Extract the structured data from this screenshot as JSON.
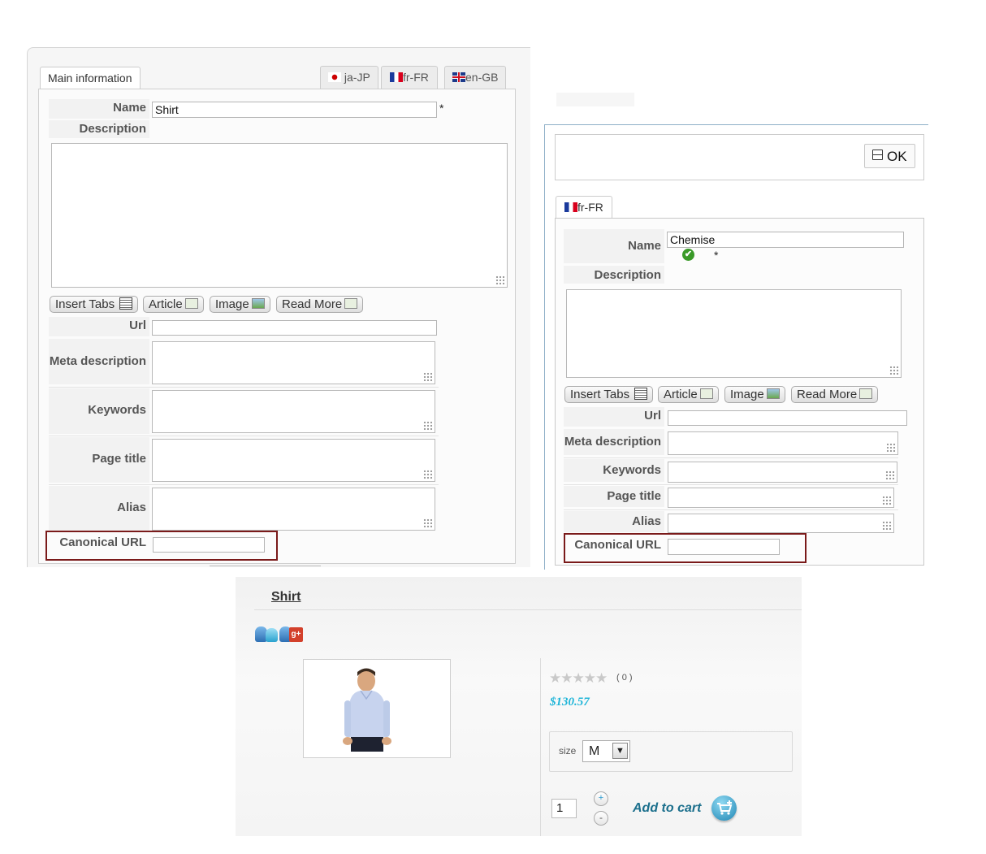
{
  "left_panel": {
    "tabs": [
      {
        "label": "Main information"
      },
      {
        "label": "ja-JP"
      },
      {
        "label": "fr-FR"
      },
      {
        "label": "en-GB"
      }
    ],
    "name_label": "Name",
    "name_value": "Shirt",
    "required_mark": "*",
    "description_label": "Description",
    "url_label": "Url",
    "meta_description_label": "Meta description",
    "keywords_label": "Keywords",
    "page_title_label": "Page title",
    "alias_label": "Alias",
    "canonical_url_label": "Canonical URL"
  },
  "editor_buttons": {
    "insert_tabs": "Insert Tabs",
    "article": "Article",
    "image": "Image",
    "read_more": "Read More"
  },
  "right_panel": {
    "ok_label": "OK",
    "tab_label": "fr-FR",
    "name_label": "Name",
    "name_value": "Chemise",
    "required_mark": "*",
    "description_label": "Description",
    "url_label": "Url",
    "meta_description_label": "Meta description",
    "keywords_label": "Keywords",
    "page_title_label": "Page title",
    "alias_label": "Alias",
    "canonical_url_label": "Canonical URL"
  },
  "product": {
    "title": "Shirt",
    "rating_count": "( 0 )",
    "rating_stars": 0,
    "price": "$130.57",
    "size_label": "size",
    "size_value": "M",
    "quantity": "1",
    "plus": "+",
    "minus": "-",
    "add_to_cart": "Add to cart"
  },
  "icons": [
    "calendar-icon",
    "article-icon",
    "image-icon",
    "save-icon",
    "check-icon",
    "star-icon",
    "cart-icon",
    "share-icon",
    "chevron-down-icon"
  ],
  "colors": {
    "highlight_box": "#7a1a1a",
    "price": "#1fb5d8",
    "add_to_cart": "#1b6f8c",
    "check": "#3a9a28"
  }
}
